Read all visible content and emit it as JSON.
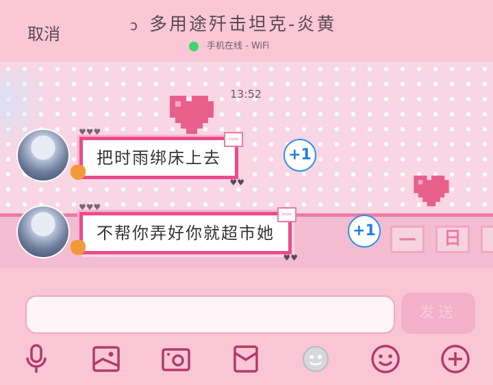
{
  "header": {
    "cancel_label": "取消",
    "title": "多用途歼击坦克-炎黄",
    "status_text": "手机在线 - WiFi",
    "status_arrow": "›",
    "ear_icon": "ear-icon"
  },
  "chat": {
    "time": "13:52",
    "messages": [
      {
        "text": "把时雨绑床上去",
        "plus": "+1"
      },
      {
        "text": "不帮你弄好你就超市她",
        "plus": "+1"
      }
    ],
    "tag_text": "xxxx",
    "hearts_small": "♥♥♥",
    "hearts_tail": "♥♥",
    "window_buttons": [
      "—",
      "日",
      "×"
    ]
  },
  "composer": {
    "input_value": "",
    "send_label": "发送"
  },
  "toolbar": {
    "icons": [
      "microphone-icon",
      "image-icon",
      "camera-icon",
      "red-packet-icon",
      "sticker-icon",
      "emoji-icon",
      "plus-icon"
    ]
  },
  "colors": {
    "accent": "#ec4b8d",
    "background": "#f9c6d6",
    "online": "#3cd66a",
    "badge": "#1f7fe6",
    "icon": "#b2396a"
  }
}
